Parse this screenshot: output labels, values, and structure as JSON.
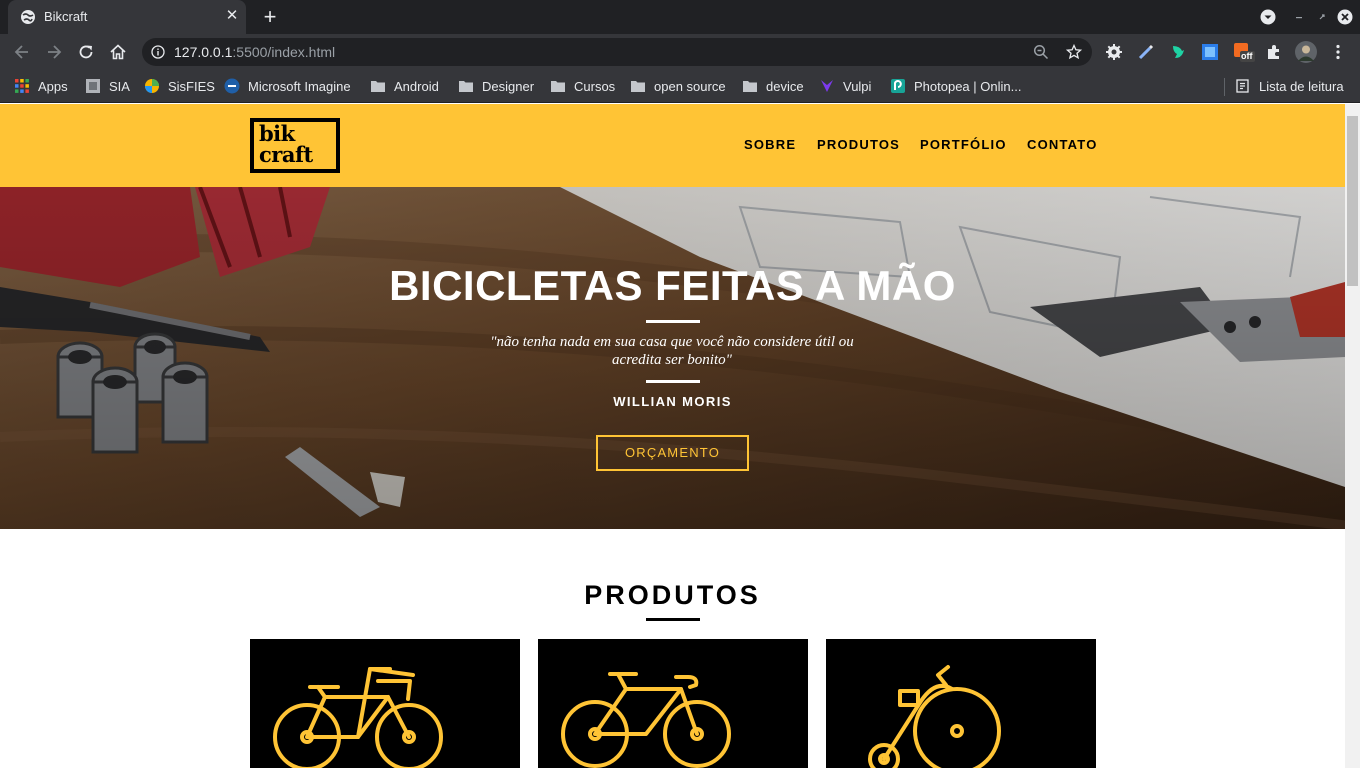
{
  "browser": {
    "tab_title": "Bikcraft",
    "url_host": "127.0.0.1",
    "url_rest": ":5500/index.html",
    "bookmarks": [
      "Apps",
      "SIA",
      "SisFIES",
      "Microsoft Imagine",
      "Android",
      "Designer",
      "Cursos",
      "open source",
      "device",
      "Vulpi",
      "Photopea | Onlin..."
    ],
    "reading_list": "Lista de leitura",
    "extension_badge": "off"
  },
  "site": {
    "logo_text": "bik\ncraft",
    "nav": [
      "SOBRE",
      "PRODUTOS",
      "PORTFÓLIO",
      "CONTATO"
    ],
    "hero": {
      "title": "BICICLETAS FEITAS A MÃO",
      "quote": "\"não tenha nada em sua casa que você não considere útil ou acredita ser bonito\"",
      "author": "WILLIAN MORIS",
      "cta": "ORÇAMENTO"
    },
    "products_title": "PRODUTOS"
  },
  "colors": {
    "brand_yellow": "#ffc435",
    "chrome_dark": "#202124",
    "chrome_mid": "#35363a"
  }
}
